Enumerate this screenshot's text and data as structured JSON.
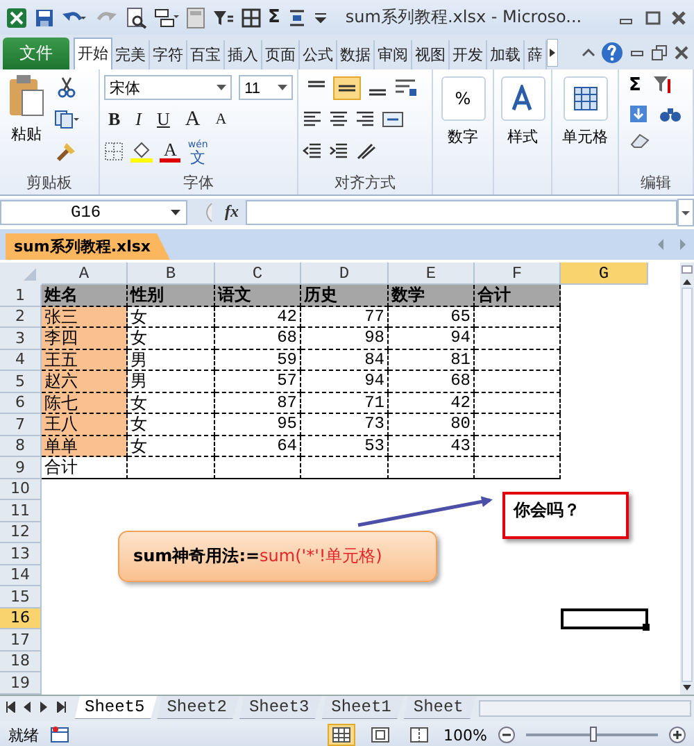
{
  "title_bar": {
    "autosum": "Σ",
    "title": "sum系列教程.xlsx  -  Microso..."
  },
  "ribbon": {
    "file_tab": "文件",
    "tabs": [
      {
        "label": "开始",
        "selected": true
      },
      {
        "label": "完美",
        "selected": false
      },
      {
        "label": "字符",
        "selected": false
      },
      {
        "label": "百宝",
        "selected": false
      },
      {
        "label": "插入",
        "selected": false
      },
      {
        "label": "页面",
        "selected": false
      },
      {
        "label": "公式",
        "selected": false
      },
      {
        "label": "数据",
        "selected": false
      },
      {
        "label": "审阅",
        "selected": false
      },
      {
        "label": "视图",
        "selected": false
      },
      {
        "label": "开发",
        "selected": false
      },
      {
        "label": "加载",
        "selected": false
      },
      {
        "label": "薛",
        "selected": false
      }
    ],
    "clipboard": {
      "paste": "粘贴",
      "label": "剪贴板"
    },
    "font": {
      "name": "宋体",
      "size": "11",
      "bold": "B",
      "italic": "I",
      "underline": "U",
      "grow": "A",
      "shrink": "A",
      "font_color": "A",
      "phonetic_top": "wén",
      "phonetic_bottom": "文",
      "label": "字体"
    },
    "alignment": {
      "vertical": [
        {
          "selected": false
        },
        {
          "selected": true
        },
        {
          "selected": false
        }
      ],
      "label": "对齐方式"
    },
    "number": {
      "symbol": "%",
      "label": "数字"
    },
    "styles": {
      "label": "样式"
    },
    "cells": {
      "label": "单元格"
    },
    "editing": {
      "autosum": "Σ",
      "label": "编辑"
    }
  },
  "formula_bar": {
    "name_box": "G16",
    "function": "fx"
  },
  "workbook_tab": "sum系列教程.xlsx",
  "sheet": {
    "columns": [
      {
        "label": "A",
        "selected": false
      },
      {
        "label": "B",
        "selected": false
      },
      {
        "label": "C",
        "selected": false
      },
      {
        "label": "D",
        "selected": false
      },
      {
        "label": "E",
        "selected": false
      },
      {
        "label": "F",
        "selected": false
      },
      {
        "label": "G",
        "selected": true
      }
    ],
    "rows": [
      {
        "label": "1",
        "selected": false
      },
      {
        "label": "2",
        "selected": false
      },
      {
        "label": "3",
        "selected": false
      },
      {
        "label": "4",
        "selected": false
      },
      {
        "label": "5",
        "selected": false
      },
      {
        "label": "6",
        "selected": false
      },
      {
        "label": "7",
        "selected": false
      },
      {
        "label": "8",
        "selected": false
      },
      {
        "label": "9",
        "selected": false
      },
      {
        "label": "10",
        "selected": false
      },
      {
        "label": "11",
        "selected": false
      },
      {
        "label": "12",
        "selected": false
      },
      {
        "label": "13",
        "selected": false
      },
      {
        "label": "14",
        "selected": false
      },
      {
        "label": "15",
        "selected": false
      },
      {
        "label": "16",
        "selected": true
      },
      {
        "label": "17",
        "selected": false
      },
      {
        "label": "18",
        "selected": false
      },
      {
        "label": "19",
        "selected": false
      }
    ],
    "table": [
      {
        "kind": "header",
        "cells": [
          "姓名",
          "性别",
          "语文",
          "历史",
          "数学",
          "合计"
        ]
      },
      {
        "kind": "data",
        "cells": [
          "张三",
          "女",
          "42",
          "77",
          "65"
        ]
      },
      {
        "kind": "data",
        "cells": [
          "李四",
          "女",
          "68",
          "98",
          "94"
        ]
      },
      {
        "kind": "data",
        "cells": [
          "王五",
          "男",
          "59",
          "84",
          "81"
        ]
      },
      {
        "kind": "data",
        "cells": [
          "赵六",
          "男",
          "57",
          "94",
          "68"
        ]
      },
      {
        "kind": "data",
        "cells": [
          "陈七",
          "女",
          "87",
          "71",
          "42"
        ]
      },
      {
        "kind": "data",
        "cells": [
          "王八",
          "女",
          "95",
          "73",
          "80"
        ]
      },
      {
        "kind": "data",
        "cells": [
          "单单",
          "女",
          "64",
          "53",
          "43"
        ]
      },
      {
        "kind": "total",
        "cells": [
          "合计"
        ]
      }
    ],
    "callout": {
      "label": "sum神奇用法:=",
      "formula": "sum('*'!单元格)"
    },
    "note": "你会吗？"
  },
  "sheet_tabs": [
    {
      "label": "Sheet5",
      "selected": true
    },
    {
      "label": "Sheet2",
      "selected": false
    },
    {
      "label": "Sheet3",
      "selected": false
    },
    {
      "label": "Sheet1",
      "selected": false
    },
    {
      "label": "Sheet",
      "selected": false
    }
  ],
  "status_bar": {
    "status": "就绪",
    "views": [
      {
        "selected": true
      },
      {
        "selected": false
      },
      {
        "selected": false
      }
    ],
    "zoom": "100%",
    "zoom_slider": {
      "level": 0.5
    }
  }
}
